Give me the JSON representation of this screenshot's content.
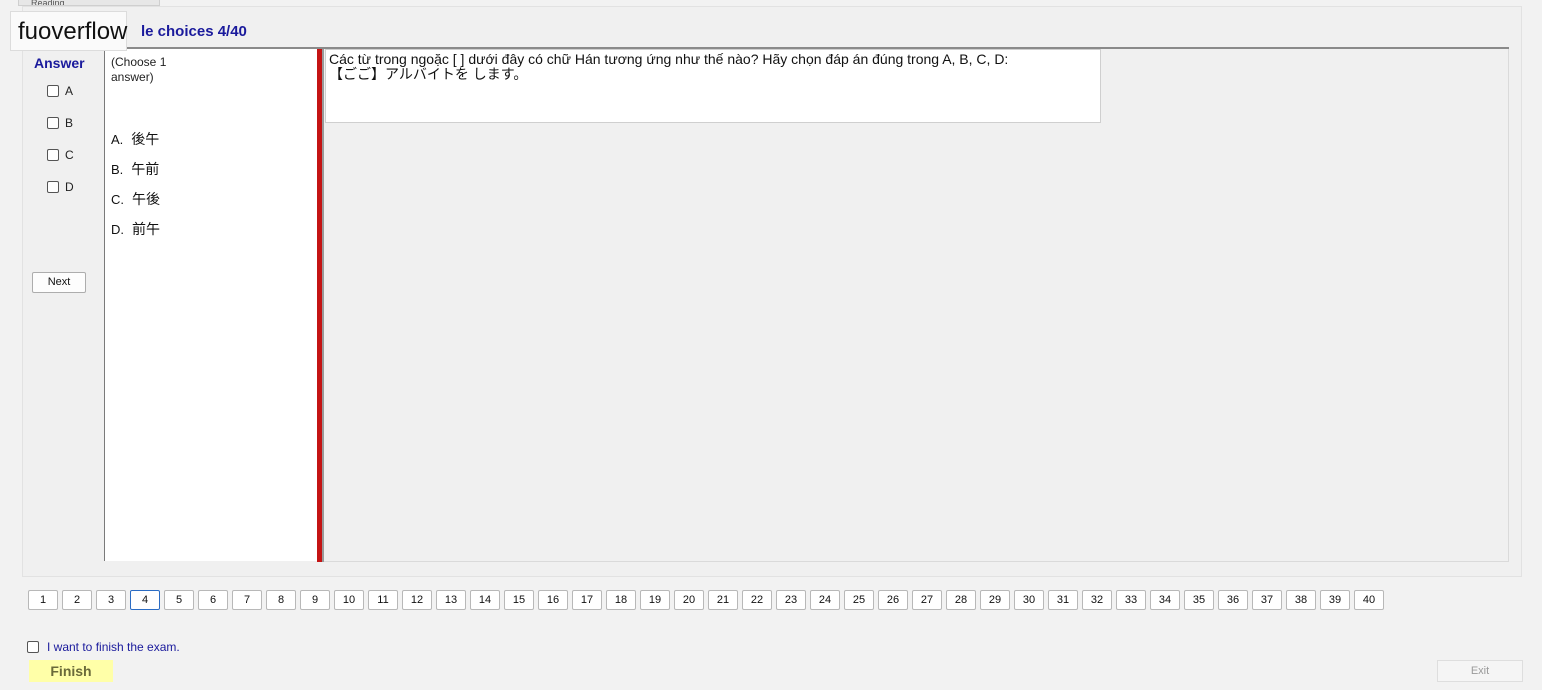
{
  "watermark": "fuoverflow",
  "top_tab": "Reading",
  "section_title": "le choices 4/40",
  "answer_label": "Answer",
  "options": [
    "A",
    "B",
    "C",
    "D"
  ],
  "next_label": "Next",
  "choose_note": "(Choose 1 answer)",
  "choices": [
    {
      "letter": "A.",
      "text": "後午"
    },
    {
      "letter": "B.",
      "text": "午前"
    },
    {
      "letter": "C.",
      "text": "午後"
    },
    {
      "letter": "D.",
      "text": "前午"
    }
  ],
  "question": {
    "line1": "Các từ trong ngoặc [     ] dưới đây có chữ Hán tương ứng như thế nào? Hãy chọn đáp án đúng trong A, B, C, D:",
    "line2": "【ごご】アルバイトを します。"
  },
  "pages": [
    "1",
    "2",
    "3",
    "4",
    "5",
    "6",
    "7",
    "8",
    "9",
    "10",
    "11",
    "12",
    "13",
    "14",
    "15",
    "16",
    "17",
    "18",
    "19",
    "20",
    "21",
    "22",
    "23",
    "24",
    "25",
    "26",
    "27",
    "28",
    "29",
    "30",
    "31",
    "32",
    "33",
    "34",
    "35",
    "36",
    "37",
    "38",
    "39",
    "40"
  ],
  "current_page": "4",
  "finish_check_label": "I want to finish the exam.",
  "finish_label": "Finish",
  "exit_label": "Exit"
}
